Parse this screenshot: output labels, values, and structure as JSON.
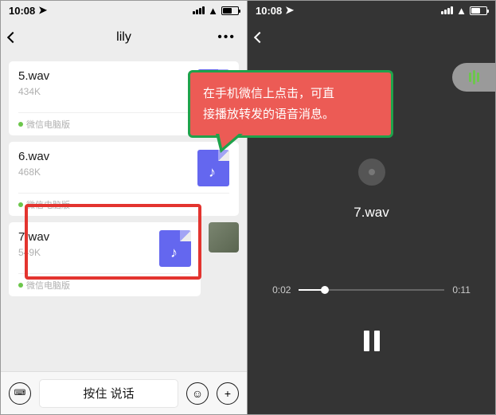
{
  "status_time": "10:08",
  "left": {
    "chat_title": "lily",
    "source_label": "微信电脑版",
    "voice_button": "按住 说话",
    "files": [
      {
        "name": "5.wav",
        "size": "434K"
      },
      {
        "name": "6.wav",
        "size": "468K"
      },
      {
        "name": "7.wav",
        "size": "549K"
      }
    ]
  },
  "right": {
    "track": "7.wav",
    "elapsed": "0:02",
    "duration": "0:11"
  },
  "callout": {
    "line1": "在手机微信上点击，可直",
    "line2": "接播放转发的语音消息。"
  }
}
